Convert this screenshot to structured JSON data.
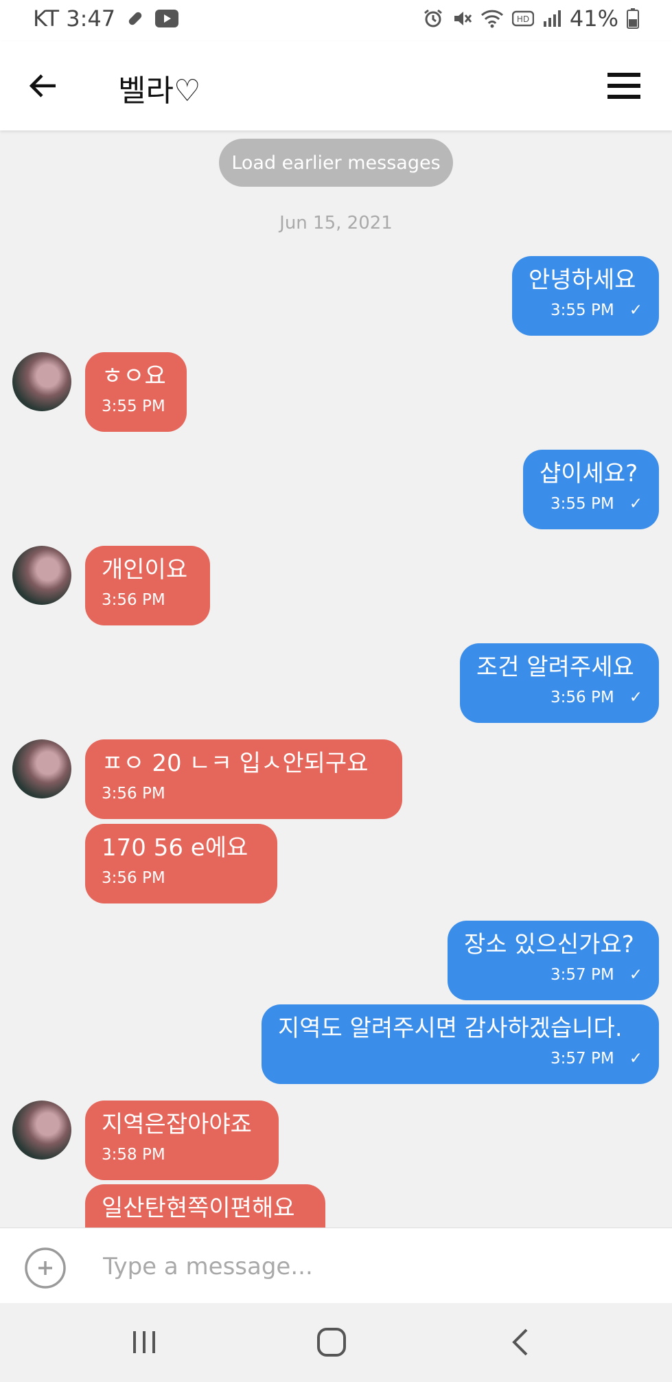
{
  "status_bar": {
    "carrier_time": "KT 3:47",
    "battery": "41%",
    "icons": [
      "pill-icon",
      "youtube-icon",
      "alarm-icon",
      "mute-icon",
      "wifi-icon",
      "hd-icon",
      "signal-icon",
      "battery-icon"
    ]
  },
  "header": {
    "title": "벨라♡",
    "icons": [
      "back-arrow-icon",
      "menu-icon"
    ]
  },
  "chat": {
    "load_earlier": "Load earlier messages",
    "date": "Jun 15, 2021",
    "messages": [
      {
        "dir": "out",
        "text": "안녕하세요",
        "time": "3:55 PM",
        "check": "✓"
      },
      {
        "dir": "in",
        "text": "ㅎㅇ요",
        "time": "3:55 PM"
      },
      {
        "dir": "out",
        "text": "샵이세요?",
        "time": "3:55 PM",
        "check": "✓"
      },
      {
        "dir": "in",
        "text": "개인이요",
        "time": "3:56 PM"
      },
      {
        "dir": "out",
        "text": "조건 알려주세요",
        "time": "3:56 PM",
        "check": "✓"
      },
      {
        "dir": "in",
        "text": "ㅍㅇ 20  ㄴㅋ 입ㅅ안되구요",
        "time": "3:56 PM"
      },
      {
        "dir": "in",
        "text": "170  56  e에요",
        "time": "3:56 PM"
      },
      {
        "dir": "out",
        "text": "장소 있으신가요?",
        "time": "3:57 PM",
        "check": "✓"
      },
      {
        "dir": "out",
        "text": "지역도 알려주시면 감사하겠습니다.",
        "time": "3:57 PM",
        "check": "✓"
      },
      {
        "dir": "in",
        "text": "지역은잡아야죠",
        "time": "3:58 PM"
      },
      {
        "dir": "in",
        "text": "일산탄현쪽이편해요",
        "time": ""
      }
    ]
  },
  "composer": {
    "placeholder": "Type a message..."
  },
  "colors": {
    "outgoing_bubble": "#3a8de8",
    "incoming_bubble": "#e5665a",
    "background": "#f1f1f1"
  }
}
